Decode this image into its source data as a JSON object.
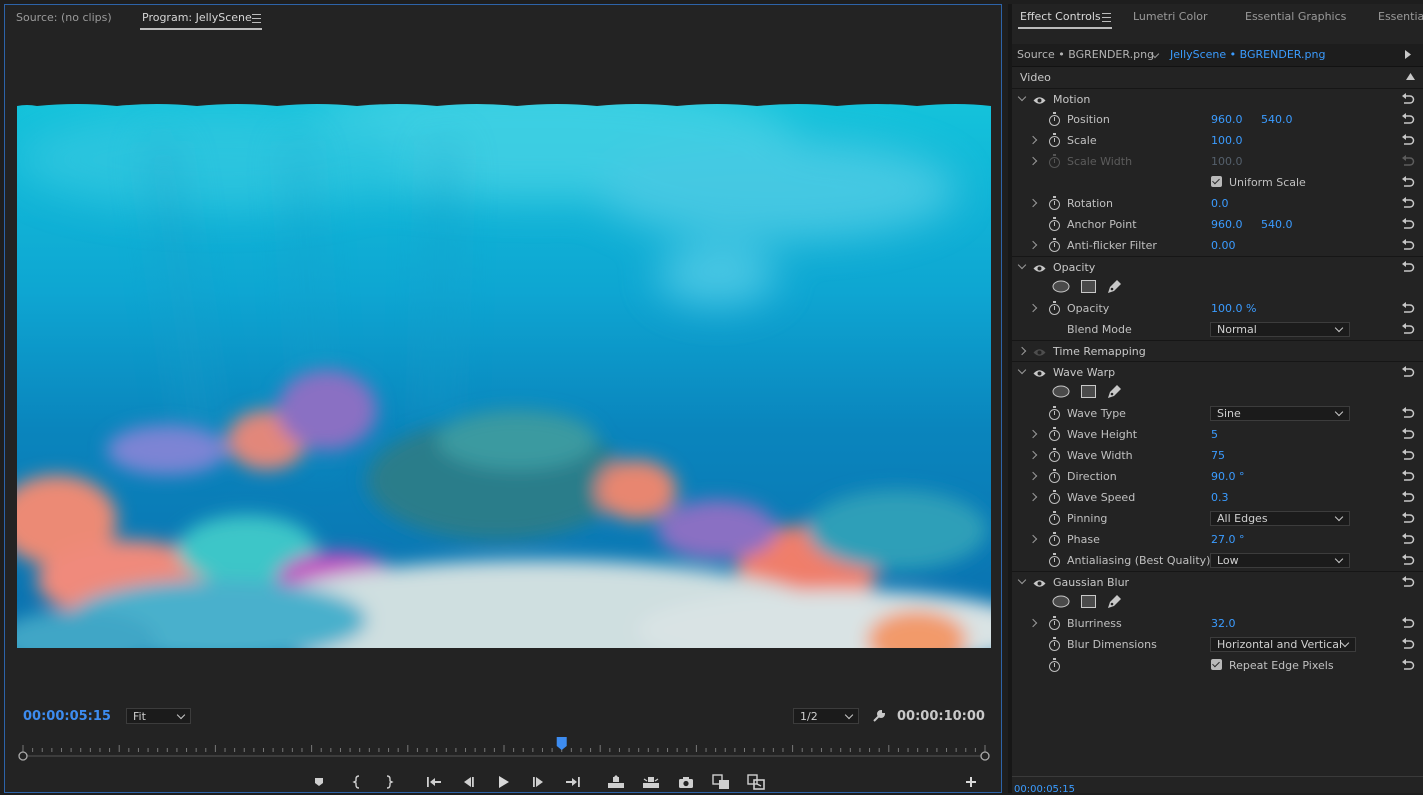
{
  "monitor": {
    "source_tab": "Source: (no clips)",
    "program_tab": "Program: JellyScene",
    "current_timecode": "00:00:05:15",
    "duration_timecode": "00:00:10:00",
    "zoom_select": "Fit",
    "resolution_select": "1/2",
    "playhead_progress": 0.56,
    "transport_icons": [
      "add-marker-icon",
      "mark-in-icon",
      "mark-out-icon",
      "go-to-in-icon",
      "step-back-icon",
      "play-icon",
      "step-forward-icon",
      "go-to-out-icon",
      "lift-icon",
      "extract-icon",
      "export-frame-icon",
      "insert-icon",
      "overwrite-icon",
      "add-button-icon"
    ]
  },
  "panel_tabs": [
    "Effect Controls",
    "Lumetri Color",
    "Essential Graphics",
    "Essential"
  ],
  "fx": {
    "source_label": "Source • BGRENDER.png",
    "sequence_label": "JellyScene • BGRENDER.png",
    "section": "Video",
    "footer_timecode": "00:00:05:15",
    "rows": [
      {
        "kind": "group",
        "label": "Motion",
        "eye": true,
        "expanded": true
      },
      {
        "kind": "prop",
        "label": "Position",
        "value": "960.0",
        "value2": "540.0",
        "twirl": false
      },
      {
        "kind": "prop",
        "label": "Scale",
        "value": "100.0",
        "twirl": true
      },
      {
        "kind": "prop",
        "label": "Scale Width",
        "value": "100.0",
        "twirl": true,
        "disabled": true
      },
      {
        "kind": "check",
        "label": "Uniform Scale"
      },
      {
        "kind": "prop",
        "label": "Rotation",
        "value": "0.0",
        "twirl": true
      },
      {
        "kind": "prop",
        "label": "Anchor Point",
        "value": "960.0",
        "value2": "540.0",
        "twirl": false
      },
      {
        "kind": "prop",
        "label": "Anti-flicker Filter",
        "value": "0.00",
        "twirl": true
      },
      {
        "kind": "group",
        "label": "Opacity",
        "eye": true,
        "expanded": true
      },
      {
        "kind": "masks"
      },
      {
        "kind": "prop",
        "label": "Opacity",
        "value": "100.0 %",
        "twirl": true
      },
      {
        "kind": "select",
        "label": "Blend Mode",
        "value": "Normal",
        "stopwatch": false
      },
      {
        "kind": "group",
        "label": "Time Remapping",
        "eye": true,
        "eye_dim": true,
        "expanded": false
      },
      {
        "kind": "group",
        "label": "Wave Warp",
        "eye": true,
        "expanded": true
      },
      {
        "kind": "masks"
      },
      {
        "kind": "select",
        "label": "Wave Type",
        "value": "Sine",
        "stopwatch": true
      },
      {
        "kind": "prop",
        "label": "Wave Height",
        "value": "5",
        "twirl": true
      },
      {
        "kind": "prop",
        "label": "Wave Width",
        "value": "75",
        "twirl": true
      },
      {
        "kind": "prop",
        "label": "Direction",
        "value": "90.0 °",
        "twirl": true
      },
      {
        "kind": "prop",
        "label": "Wave Speed",
        "value": "0.3",
        "twirl": true
      },
      {
        "kind": "select",
        "label": "Pinning",
        "value": "All Edges",
        "stopwatch": true
      },
      {
        "kind": "prop",
        "label": "Phase",
        "value": "27.0 °",
        "twirl": true
      },
      {
        "kind": "select",
        "label": "Antialiasing (Best Quality)",
        "value": "Low",
        "stopwatch": true
      },
      {
        "kind": "group",
        "label": "Gaussian Blur",
        "eye": true,
        "expanded": true
      },
      {
        "kind": "masks"
      },
      {
        "kind": "prop",
        "label": "Blurriness",
        "value": "32.0",
        "twirl": true
      },
      {
        "kind": "select",
        "label": "Blur Dimensions",
        "value": "Horizontal and Vertical",
        "stopwatch": true,
        "wide": true
      },
      {
        "kind": "check",
        "label": "Repeat Edge Pixels",
        "stopwatch": true
      }
    ]
  }
}
